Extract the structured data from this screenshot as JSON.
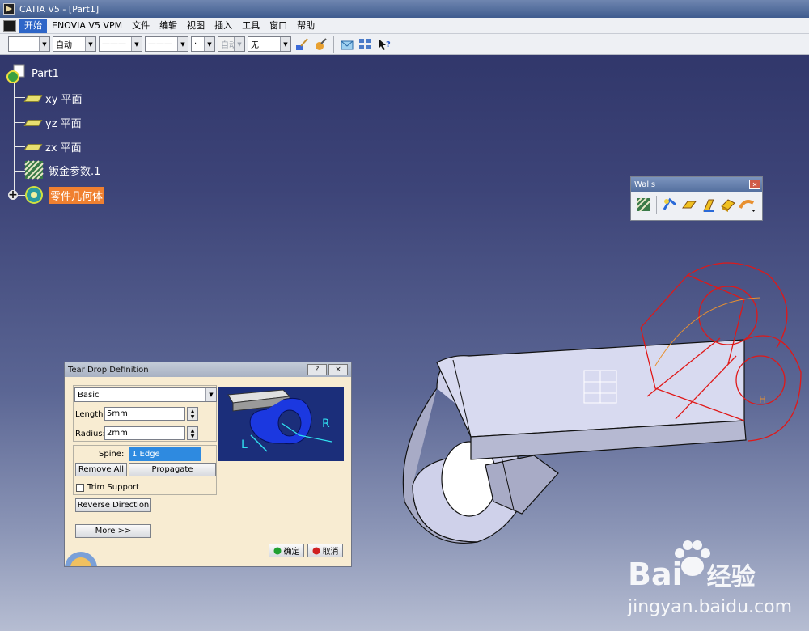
{
  "window": {
    "title": "CATIA V5 - [Part1]"
  },
  "menu": [
    "开始",
    "ENOVIA V5 VPM",
    "文件",
    "编辑",
    "视图",
    "插入",
    "工具",
    "窗口",
    "帮助"
  ],
  "toolbar": {
    "combo_color": "",
    "combo_auto": "自动",
    "combo_line1": "———",
    "combo_line2": "———",
    "combo_point": "·",
    "combo_auto_disabled": "自动",
    "combo_none": "无"
  },
  "tree": {
    "root": "Part1",
    "items": [
      "xy 平面",
      "yz 平面",
      "zx 平面",
      "钣金参数.1",
      "零件几何体"
    ]
  },
  "walls": {
    "title": "Walls"
  },
  "dialog": {
    "title": "Tear Drop Definition",
    "help_btn": "?",
    "close_btn": "×",
    "mode": "Basic",
    "length_label": "Length:",
    "length_value": "5mm",
    "radius_label": "Radius:",
    "radius_value": "2mm",
    "spine_label": "Spine:",
    "spine_value": "1 Edge",
    "remove_all": "Remove All",
    "propagate": "Propagate",
    "trim_support": "Trim Support",
    "reverse_direction": "Reverse Direction",
    "more": "More >>",
    "ok": "确定",
    "cancel": "取消",
    "preview_r": "R",
    "preview_l": "L"
  },
  "watermark": {
    "brand": "Bai",
    "brand_cn": "经验",
    "url": "jingyan.baidu.com"
  },
  "colors": {
    "background_top": "#2c3266",
    "selection": "#f08030",
    "part_face": "#d8daf0",
    "edge_red": "#e01818"
  }
}
